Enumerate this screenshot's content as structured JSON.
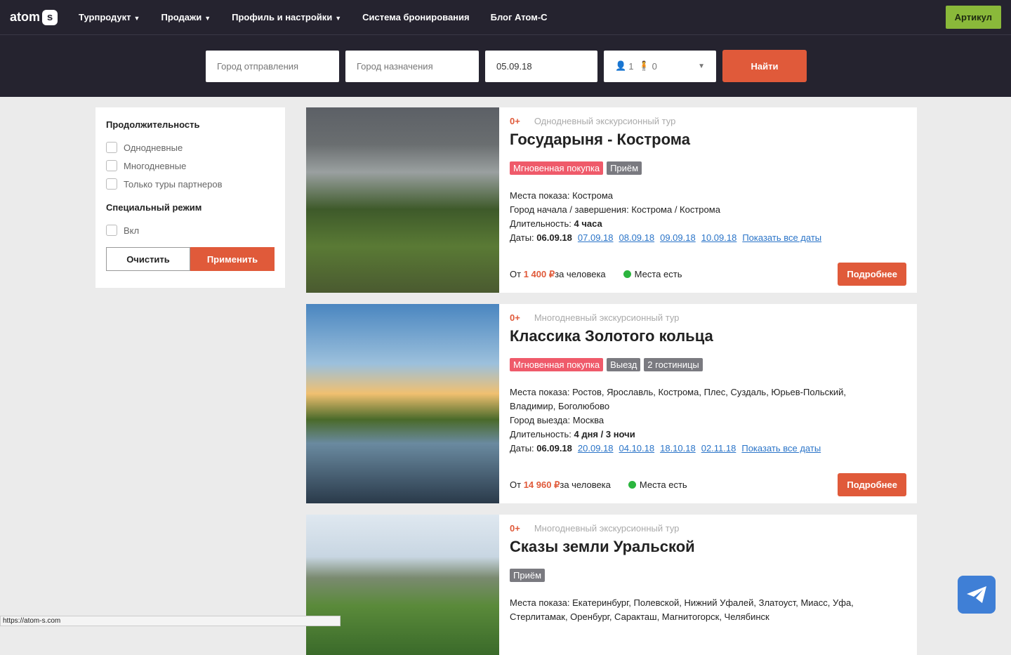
{
  "nav": {
    "logo": "atom",
    "logo_badge": "s",
    "items": [
      "Турпродукт",
      "Продажи",
      "Профиль и настройки",
      "Система бронирования",
      "Блог Атом-С"
    ],
    "artikul": "Артикул"
  },
  "search": {
    "from_placeholder": "Город отправления",
    "to_placeholder": "Город назначения",
    "date": "05.09.18",
    "adults": "1",
    "children": "0",
    "find": "Найти"
  },
  "sidebar": {
    "duration_title": "Продолжительность",
    "duration_options": [
      "Однодневные",
      "Многодневные",
      "Только туры партнеров"
    ],
    "special_title": "Специальный режим",
    "special_option": "Вкл",
    "clear": "Очистить",
    "apply": "Применить"
  },
  "tours": [
    {
      "age": "0+",
      "type": "Однодневный экскурсионный тур",
      "title": "Государыня - Кострома",
      "tags": [
        "Мгновенная покупка",
        "Приём"
      ],
      "lines": [
        [
          "Места показа: ",
          "Кострома"
        ],
        [
          "Город начала / завершения: ",
          "Кострома / Кострома"
        ]
      ],
      "duration_label": "Длительность: ",
      "duration": "4 часа",
      "dates_label": "Даты: ",
      "first_date": "06.09.18",
      "dates": [
        "07.09.18",
        "08.09.18",
        "09.09.18",
        "10.09.18"
      ],
      "all_dates": "Показать все даты",
      "price_from": "От ",
      "price": "1 400 ₽",
      "price_suffix": " за человека",
      "availability": "Места есть",
      "more": "Подробнее"
    },
    {
      "age": "0+",
      "type": "Многодневный экскурсионный тур",
      "title": "Классика Золотого кольца",
      "tags": [
        "Мгновенная покупка",
        "Выезд",
        "2 гостиницы"
      ],
      "lines": [
        [
          "Места показа: ",
          "Ростов, Ярославль, Кострома, Плес, Суздаль, Юрьев-Польский, Владимир, Боголюбово"
        ],
        [
          "Город выезда: ",
          "Москва"
        ]
      ],
      "duration_label": "Длительность: ",
      "duration": "4 дня / 3 ночи",
      "dates_label": "Даты: ",
      "first_date": "06.09.18",
      "dates": [
        "20.09.18",
        "04.10.18",
        "18.10.18",
        "02.11.18"
      ],
      "all_dates": "Показать все даты",
      "price_from": "От ",
      "price": "14 960 ₽",
      "price_suffix": " за человека",
      "availability": "Места есть",
      "more": "Подробнее"
    },
    {
      "age": "0+",
      "type": "Многодневный экскурсионный тур",
      "title": "Сказы земли Уральской",
      "tags": [
        "Приём"
      ],
      "lines": [
        [
          "Места показа: ",
          "Екатеринбург, Полевской, Нижний Уфалей, Златоуст, Миасс, Уфа, Стерлитамак, Оренбург, Саракташ, Магнитогорск, Челябинск"
        ]
      ]
    }
  ],
  "status_url": "https://atom-s.com"
}
